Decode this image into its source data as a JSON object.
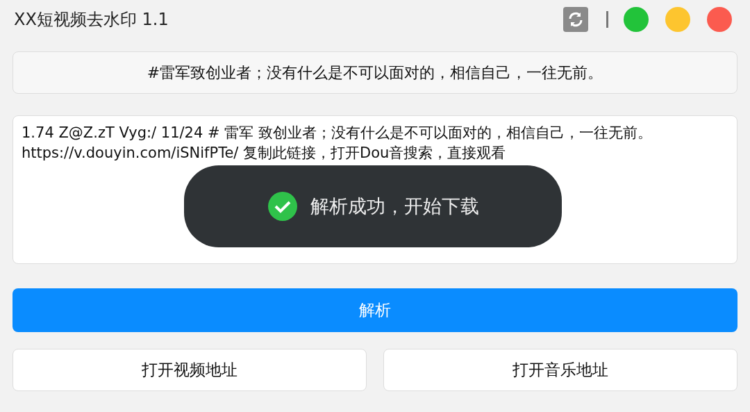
{
  "window": {
    "title": "XX短视频去水印 1.1"
  },
  "headline": "#雷军致创业者；没有什么是不可以面对的，相信自己，一往无前。",
  "input": {
    "value": "1.74 Z@Z.zT Vyg:/ 11/24 # 雷军 致创业者；没有什么是不可以面对的，相信自己，一往无前。  https://v.douyin.com/iSNifPTe/ 复制此链接，打开Dou音搜索，直接观看"
  },
  "toast": {
    "kind": "success",
    "text": "解析成功，开始下载"
  },
  "parse_button": "解析",
  "buttons": [
    "打开视频地址",
    "打开音乐地址"
  ]
}
